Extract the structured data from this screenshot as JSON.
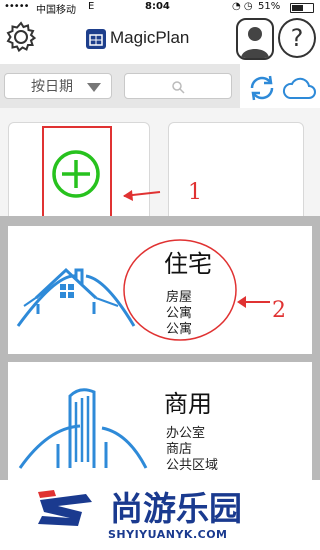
{
  "status_bar": {
    "signal": "•••••",
    "carrier": "中国移动",
    "network": "E",
    "time": "8:04",
    "icons": "◔ ◷",
    "battery_percent": "51%",
    "battery_level": 0.51
  },
  "header": {
    "app_title": "MagicPlan",
    "help_label": "?"
  },
  "filter": {
    "sort_label": "按日期"
  },
  "annotations": {
    "arrow1_label": "1",
    "arrow2_label": "2"
  },
  "options": [
    {
      "title": "住宅",
      "subtypes": [
        "房屋",
        "公寓",
        "公寓"
      ]
    },
    {
      "title": "商用",
      "subtypes": [
        "办公室",
        "商店",
        "公共区域"
      ]
    }
  ],
  "watermark": {
    "logo_text": "尚游乐园",
    "url": "SHYIYUANYK.COM"
  },
  "colors": {
    "accent_blue": "#2e8ad8",
    "plus_green": "#27c21e",
    "annotation_red": "#e03232",
    "watermark_blue": "#1a3a8f"
  }
}
